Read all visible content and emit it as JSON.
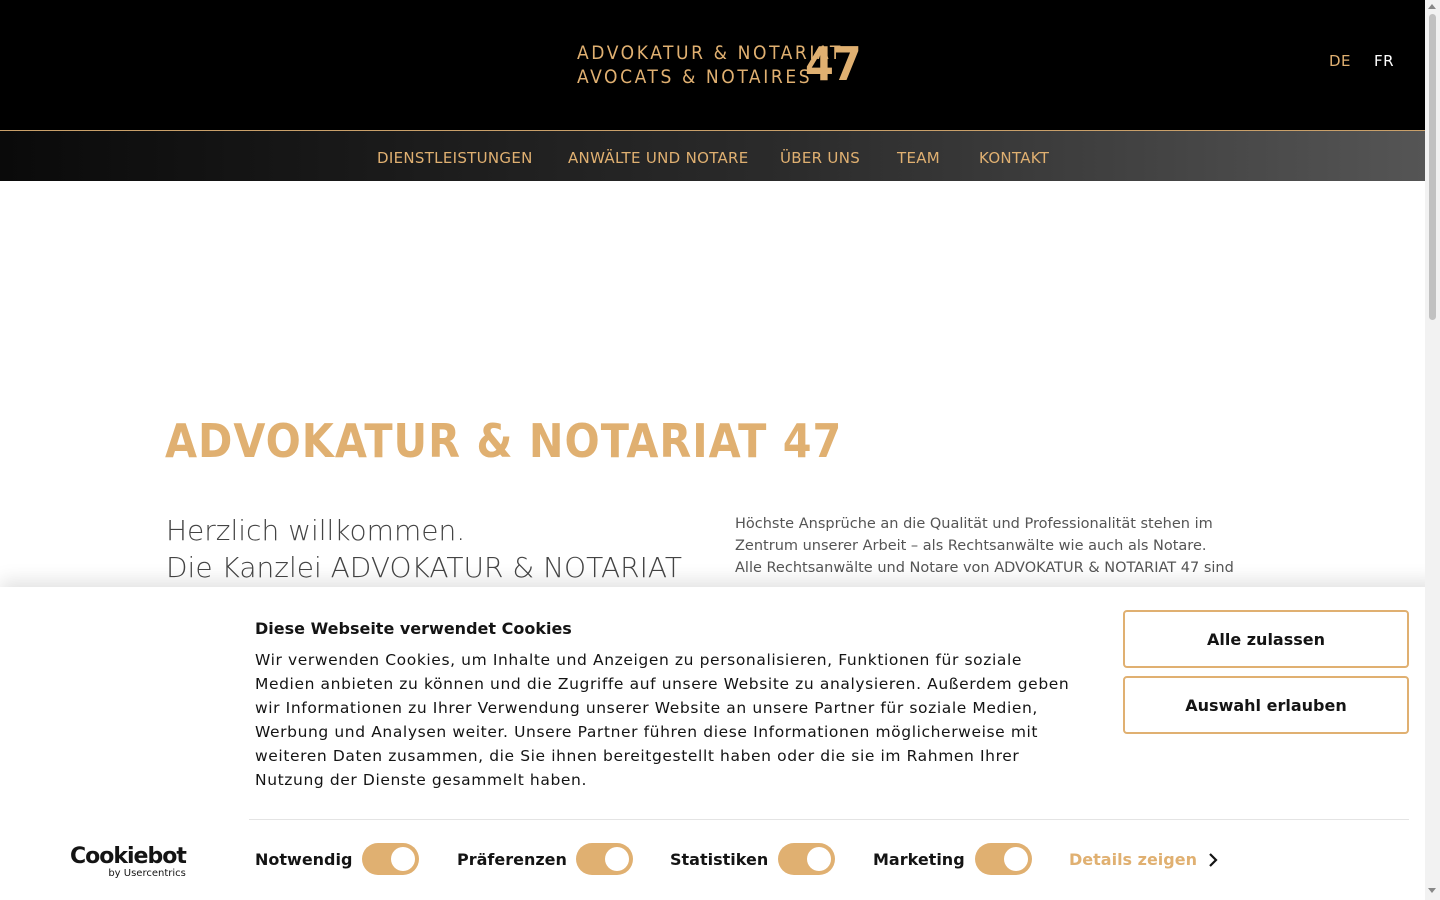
{
  "header": {
    "logo_line1": "ADVOKATUR & NOTARIAT",
    "logo_line2": "AVOCATS & NOTAIRES",
    "logo_number": "47",
    "languages": [
      "DE",
      "FR"
    ],
    "active_language": "DE"
  },
  "nav": {
    "items": [
      "DIENSTLEISTUNGEN",
      "ANWÄLTE UND NOTARE",
      "ÜBER UNS",
      "TEAM",
      "KONTAKT"
    ]
  },
  "main": {
    "headline": "ADVOKATUR & NOTARIAT 47",
    "welcome_line1": "Herzlich willkommen.",
    "welcome_line2": "Die Kanzlei ADVOKATUR & NOTARIAT",
    "intro_line1": "Höchste Ansprüche an die Qualität und Professionalität stehen im",
    "intro_line2": "Zentrum unserer Arbeit – als Rechtsanwälte wie auch als Notare.",
    "intro_line3": "Alle Rechtsanwälte und Notare von ADVOKATUR & NOTARIAT 47 sind"
  },
  "cookie": {
    "title": "Diese Webseite verwendet Cookies",
    "text": "Wir verwenden Cookies, um Inhalte und Anzeigen zu personalisieren, Funktionen für soziale Medien anbieten zu können und die Zugriffe auf unsere Website zu analysieren. Außerdem geben wir Informationen zu Ihrer Verwendung unserer Website an unsere Partner für soziale Medien, Werbung und Analysen weiter. Unsere Partner führen diese Informationen möglicherweise mit weiteren Daten zusammen, die Sie ihnen bereitgestellt haben oder die sie im Rahmen Ihrer Nutzung der Dienste gesammelt haben.",
    "allow_all": "Alle zulassen",
    "allow_selection": "Auswahl erlauben",
    "brand": "Cookiebot",
    "brand_sub": "by Usercentrics",
    "toggles": [
      {
        "label": "Notwendig",
        "on": true
      },
      {
        "label": "Präferenzen",
        "on": true
      },
      {
        "label": "Statistiken",
        "on": true
      },
      {
        "label": "Marketing",
        "on": true
      }
    ],
    "details": "Details zeigen"
  },
  "colors": {
    "gold": "#e0b071",
    "header_bg": "#000000"
  },
  "icons": [
    "chevron-right-icon",
    "cookiebot-logo"
  ]
}
